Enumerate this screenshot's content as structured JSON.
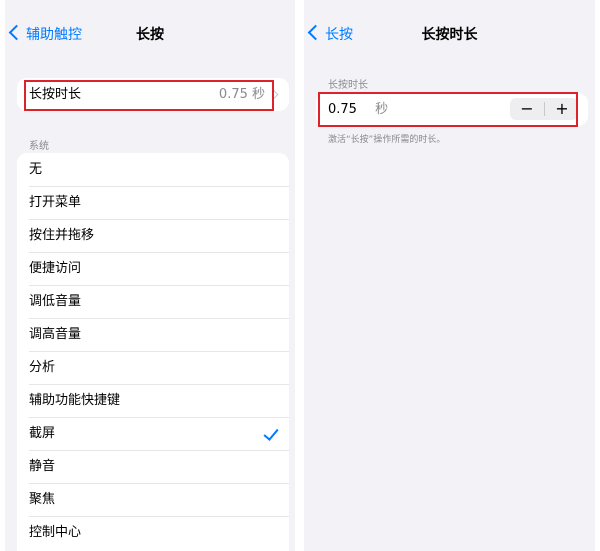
{
  "left": {
    "back_label": "辅助触控",
    "title": "长按",
    "long_press_row": {
      "label": "长按时长",
      "value": "0.75 秒"
    },
    "section_label": "系统",
    "actions": [
      "无",
      "打开菜单",
      "按住并拖移",
      "便捷访问",
      "调低音量",
      "调高音量",
      "分析",
      "辅助功能快捷键",
      "截屏",
      "静音",
      "聚焦",
      "控制中心"
    ],
    "selected_action": "截屏"
  },
  "right": {
    "back_label": "长按",
    "title": "长按时长",
    "section_label": "长按时长",
    "duration_value": "0.75",
    "duration_unit": "秒",
    "minus_label": "−",
    "plus_label": "+",
    "footnote": "激活“长按”操作所需的时长。"
  },
  "colors": {
    "accent": "#007aff",
    "highlight": "#d9252a",
    "background": "#f2f2f7"
  },
  "icons": [
    "chevron-left-icon",
    "chevron-right-icon",
    "checkmark-icon"
  ]
}
